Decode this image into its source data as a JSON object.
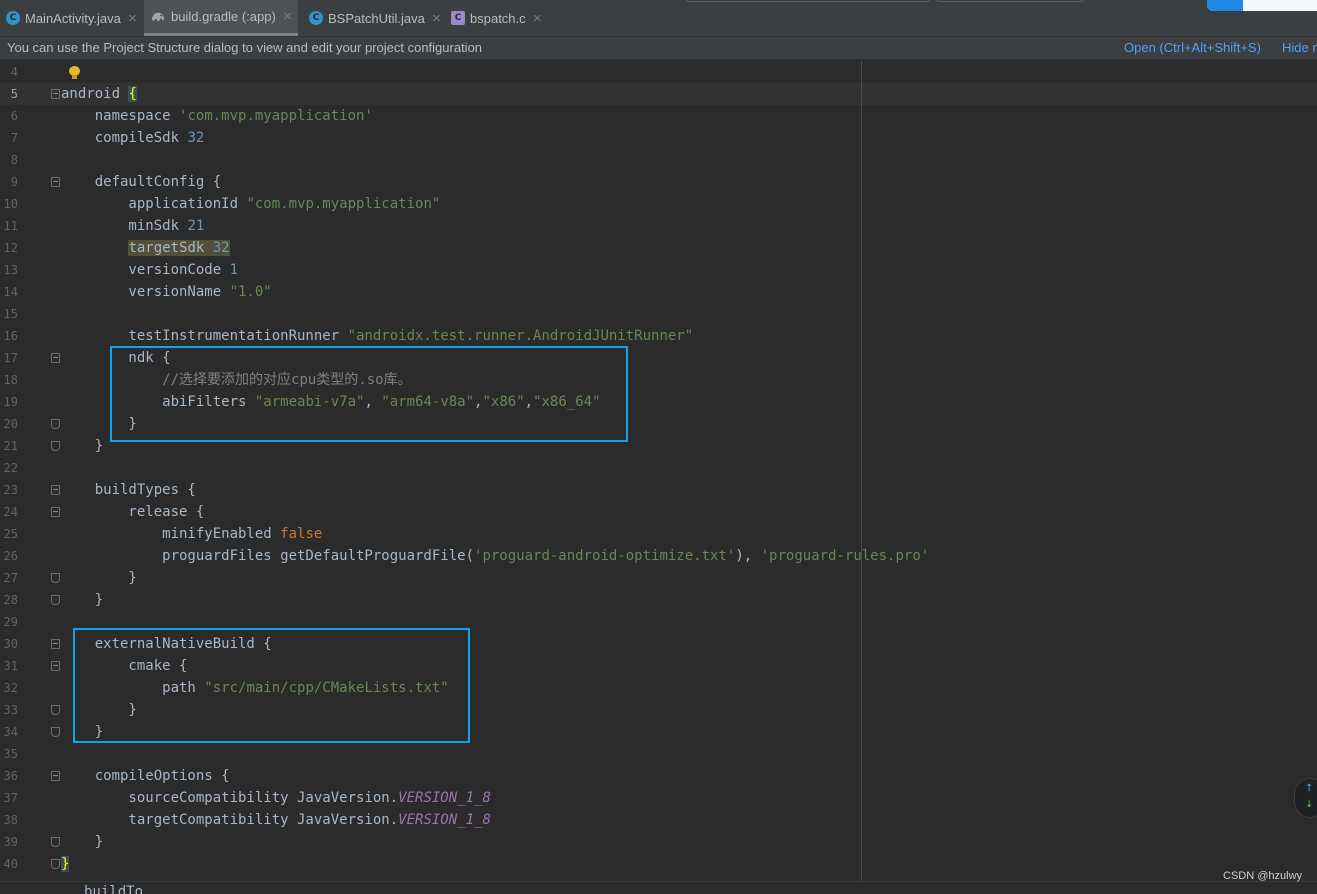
{
  "tabs": [
    {
      "label": "MainActivity.java",
      "icon": "class-icon",
      "icon_glyph": "C",
      "active": false
    },
    {
      "label": "build.gradle (:app)",
      "icon": "gradle-elephant-icon",
      "active": true
    },
    {
      "label": "BSPatchUtil.java",
      "icon": "class-icon",
      "icon_glyph": "C",
      "active": false
    },
    {
      "label": "bspatch.c",
      "icon": "c-file-icon",
      "icon_glyph": "C",
      "active": false
    }
  ],
  "close_glyph": "✕",
  "banner": {
    "message": "You can use the Project Structure dialog to view and edit your project configuration",
    "open_link": "Open (Ctrl+Alt+Shift+S)",
    "hide_link": "Hide n"
  },
  "editor": {
    "current_line_number": "5",
    "line_numbers": [
      "4",
      "5",
      "6",
      "7",
      "8",
      "9",
      "10",
      "11",
      "12",
      "13",
      "14",
      "15",
      "16",
      "17",
      "18",
      "19",
      "20",
      "21",
      "22",
      "23",
      "24",
      "25",
      "26",
      "27",
      "28",
      "29",
      "30",
      "31",
      "32",
      "33",
      "34",
      "35",
      "36",
      "37",
      "38",
      "39",
      "40"
    ],
    "lines": {
      "l5": {
        "kw": "android ",
        "brace": "{"
      },
      "l6": {
        "a": "    namespace ",
        "s": "'com.mvp.myapplication'"
      },
      "l7": {
        "a": "    compileSdk ",
        "n": "32"
      },
      "l9": {
        "a": "    defaultConfig {"
      },
      "l10": {
        "a": "        applicationId ",
        "s": "\"com.mvp.myapplication\""
      },
      "l11": {
        "a": "        minSdk ",
        "n": "21"
      },
      "l12": {
        "pad": "        ",
        "hl": "targetSdk",
        "sp": " ",
        "n": "32"
      },
      "l13": {
        "a": "        versionCode ",
        "n": "1"
      },
      "l14": {
        "a": "        versionName ",
        "s": "\"1.0\""
      },
      "l16": {
        "a": "        testInstrumentationRunner ",
        "s": "\"androidx.test.runner.AndroidJUnitRunner\""
      },
      "l17": {
        "a": "        ndk {"
      },
      "l18": {
        "pad": "            ",
        "c": "//选择要添加的对应cpu类型的.so库。"
      },
      "l19": {
        "a": "            abiFilters ",
        "s1": "\"armeabi-v7a\"",
        "sep1": ", ",
        "s2": "\"arm64-v8a\"",
        "sep2": ",",
        "s3": "\"x86\"",
        "sep3": ",",
        "s4": "\"x86_64\""
      },
      "l20": {
        "a": "        }"
      },
      "l21": {
        "a": "    }"
      },
      "l23": {
        "a": "    buildTypes {"
      },
      "l24": {
        "a": "        release {"
      },
      "l25": {
        "a": "            minifyEnabled ",
        "k": "false"
      },
      "l26": {
        "a": "            proguardFiles getDefaultProguardFile(",
        "s1": "'proguard-android-optimize.txt'",
        "sep": "), ",
        "s2": "'proguard-rules.pro'"
      },
      "l27": {
        "a": "        }"
      },
      "l28": {
        "a": "    }"
      },
      "l30": {
        "a": "    externalNativeBuild {"
      },
      "l31": {
        "a": "        cmake {"
      },
      "l32": {
        "a": "            path ",
        "s": "\"src/main/cpp/CMakeLists.txt\""
      },
      "l33": {
        "a": "        }"
      },
      "l34": {
        "a": "    }"
      },
      "l36": {
        "a": "    compileOptions {"
      },
      "l37": {
        "a": "        sourceCompatibility JavaVersion.",
        "const": "VERSION_1_8"
      },
      "l38": {
        "a": "        targetCompatibility JavaVersion.",
        "const": "VERSION_1_8"
      },
      "l39": {
        "a": "    }"
      },
      "l40": {
        "brace": "}"
      },
      "l41": {
        "a": "buildTo"
      }
    }
  },
  "colors": {
    "highlight_box": "#11a4ee",
    "string": "#6a8759",
    "number": "#6897bb",
    "keyword": "#cc7832",
    "comment": "#808080",
    "constant": "#9876aa"
  },
  "watermark": "CSDN @hzulwy"
}
